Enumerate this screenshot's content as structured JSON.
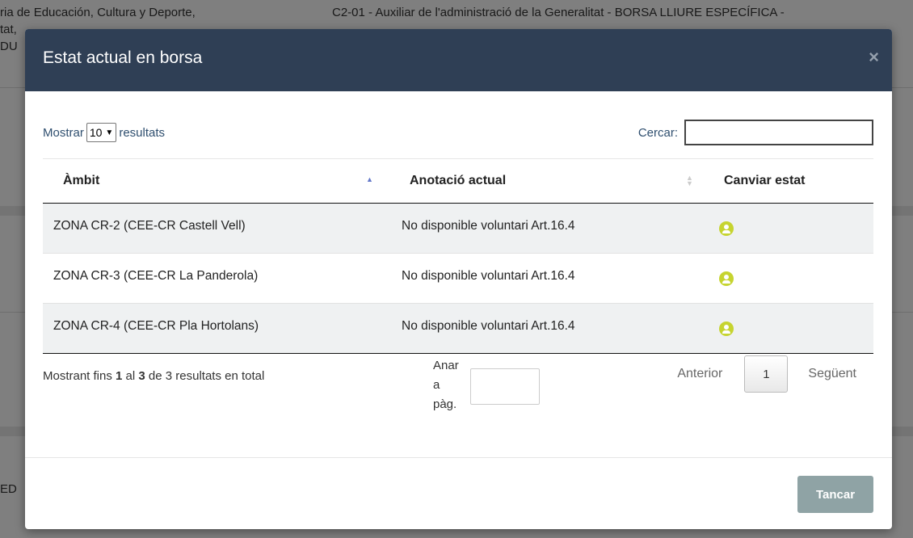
{
  "background": {
    "line1_left": "ria de Educación, Cultura y Deporte,",
    "line1_right": "C2-01 - Auxiliar de l'administració de la Generalitat - BORSA LLIURE ESPECÍFICA -",
    "line2_left": "tat,",
    "line3_left": "DU",
    "line4_left": "ED"
  },
  "modal": {
    "title": "Estat actual en borsa",
    "close_glyph": "×",
    "length": {
      "label_before": "Mostrar",
      "selected": "10",
      "label_after": "resultats"
    },
    "search": {
      "label": "Cercar:",
      "value": ""
    },
    "columns": [
      "Àmbit",
      "Anotació actual",
      "Canviar estat"
    ],
    "rows": [
      {
        "ambit": "ZONA CR-2 (CEE-CR Castell Vell)",
        "anotacio": "No disponible voluntari Art.16.4",
        "icon": "user-circle-icon"
      },
      {
        "ambit": "ZONA CR-3 (CEE-CR La Panderola)",
        "anotacio": "No disponible voluntari Art.16.4",
        "icon": "user-circle-icon"
      },
      {
        "ambit": "ZONA CR-4 (CEE-CR Pla Hortolans)",
        "anotacio": "No disponible voluntari Art.16.4",
        "icon": "user-circle-icon"
      }
    ],
    "info": {
      "prefix": "Mostrant fins ",
      "from": "1",
      "mid": " al ",
      "to": "3",
      "suffix": " de 3 resultats en total"
    },
    "goto": {
      "w1": "Anar",
      "w2": "a",
      "w3": "pàg.",
      "value": ""
    },
    "pager": {
      "prev": "Anterior",
      "page": "1",
      "next": "Següent"
    },
    "footer": {
      "close_label": "Tancar"
    }
  },
  "colors": {
    "header": "#2f3f55",
    "icon": "#c6d430",
    "close_button": "#8fa3a5"
  }
}
